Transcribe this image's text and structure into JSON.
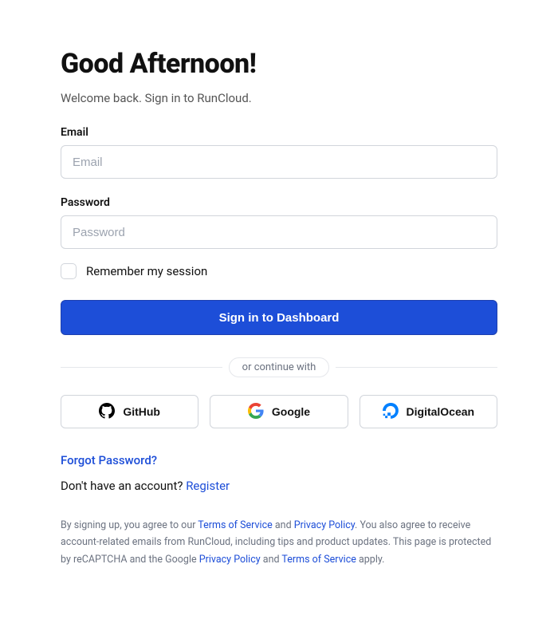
{
  "heading": "Good Afternoon!",
  "subheading": "Welcome back. Sign in to RunCloud.",
  "email": {
    "label": "Email",
    "placeholder": "Email"
  },
  "password": {
    "label": "Password",
    "placeholder": "Password"
  },
  "remember_label": "Remember my session",
  "signin_button": "Sign in to Dashboard",
  "divider_text": "or continue with",
  "social": {
    "github": "GitHub",
    "google": "Google",
    "digitalocean": "DigitalOcean"
  },
  "forgot_password": "Forgot Password?",
  "register": {
    "prompt": "Don't have an account? ",
    "link": "Register"
  },
  "legal": {
    "part1": "By signing up, you agree to our ",
    "tos": "Terms of Service",
    "part2": " and ",
    "privacy": "Privacy Policy",
    "part3": ". You also agree to receive account-related emails from RunCloud, including tips and product updates. This page is protected by reCAPTCHA and the Google ",
    "google_privacy": "Privacy Policy",
    "part4": " and ",
    "google_tos": "Terms of Service",
    "part5": " apply."
  }
}
